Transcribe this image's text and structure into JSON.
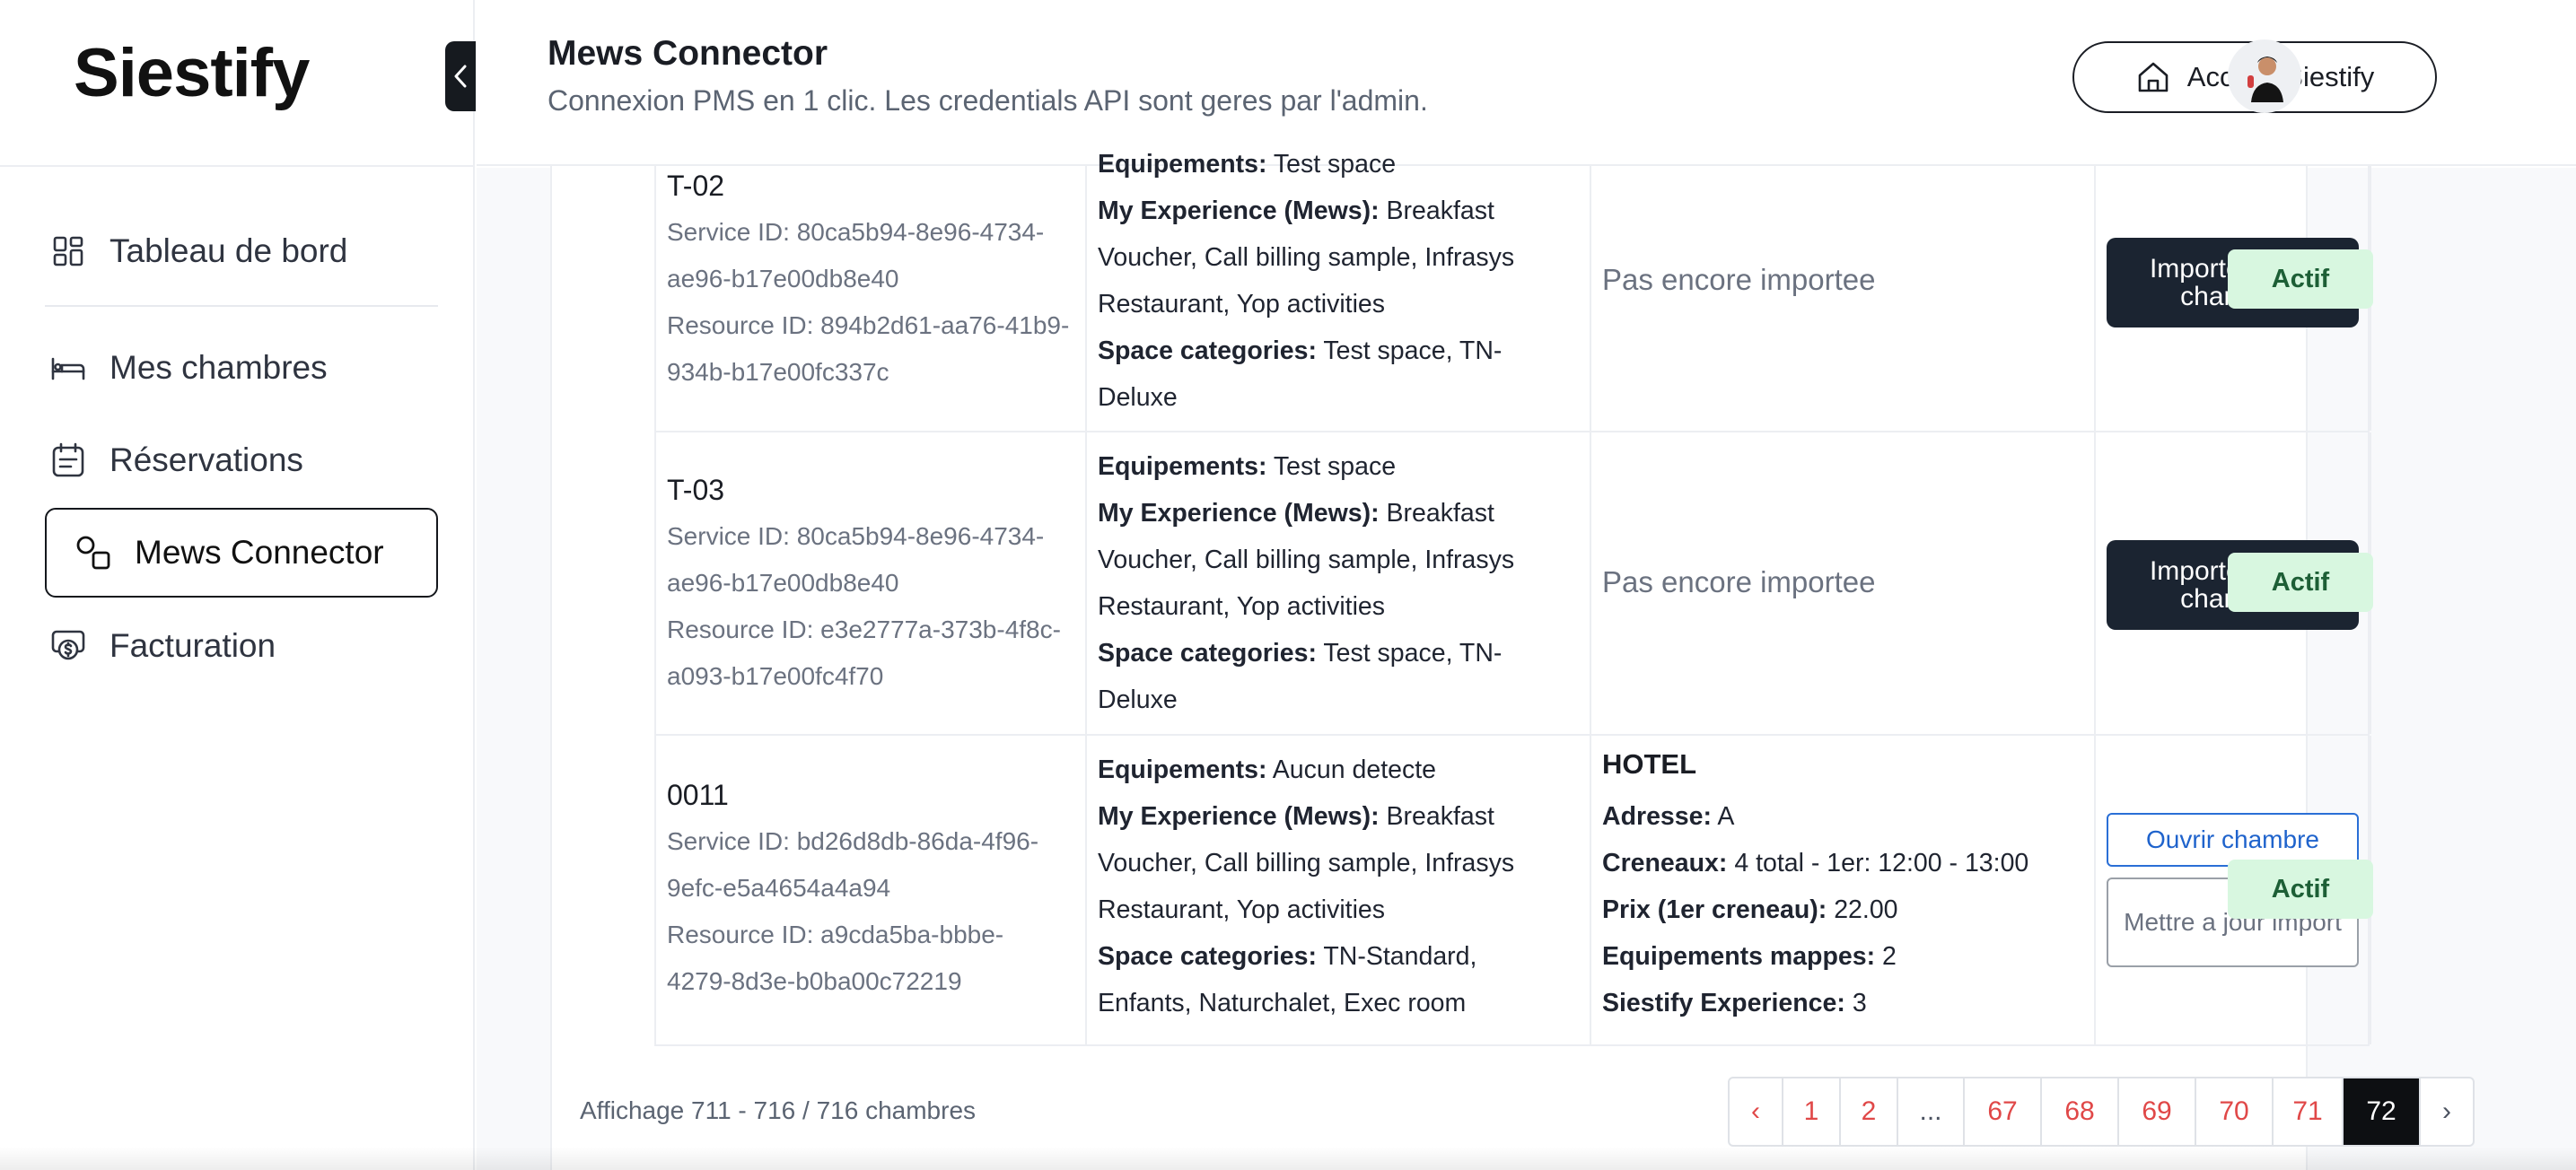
{
  "brand": {
    "logo_text": "Siestify"
  },
  "sidebar": {
    "items": [
      {
        "label": "Tableau de bord",
        "icon": "dashboard-icon"
      },
      {
        "label": "Mes chambres",
        "icon": "bed-icon"
      },
      {
        "label": "Réservations",
        "icon": "calendar-icon"
      },
      {
        "label": "Mews Connector",
        "icon": "connector-icon",
        "active": true
      },
      {
        "label": "Facturation",
        "icon": "billing-icon"
      }
    ]
  },
  "header": {
    "title": "Mews Connector",
    "subtitle": "Connexion PMS en 1 clic. Les credentials API sont geres par l'admin.",
    "home_button": "Accueil Siestify"
  },
  "rows": [
    {
      "code": "T-02",
      "service_id_1": "Service ID: 80ca5b94-8e96-4734-",
      "service_id_2": "ae96-b17e00db8e40",
      "resource_id_1": "Resource ID: 894b2d61-aa76-41b9-",
      "resource_id_2": "934b-b17e00fc337c",
      "equipements_label": "Equipements:",
      "equipements_value": "Test space",
      "experience_label": "My Experience (Mews):",
      "experience_value_1": "Breakfast",
      "experience_value_2": "Voucher, Call billing sample, Infrasys",
      "experience_value_3": "Restaurant, Yop activities",
      "space_label": "Space categories:",
      "space_value_1": "Test space, TN-",
      "space_value_2": "Deluxe",
      "import_status": "Pas encore importee",
      "action": "Importer cette chambre",
      "status": "Actif"
    },
    {
      "code": "T-03",
      "service_id_1": "Service ID: 80ca5b94-8e96-4734-",
      "service_id_2": "ae96-b17e00db8e40",
      "resource_id_1": "Resource ID: e3e2777a-373b-4f8c-",
      "resource_id_2": "a093-b17e00fc4f70",
      "equipements_label": "Equipements:",
      "equipements_value": "Test space",
      "experience_label": "My Experience (Mews):",
      "experience_value_1": "Breakfast",
      "experience_value_2": "Voucher, Call billing sample, Infrasys",
      "experience_value_3": "Restaurant, Yop activities",
      "space_label": "Space categories:",
      "space_value_1": "Test space, TN-",
      "space_value_2": "Deluxe",
      "import_status": "Pas encore importee",
      "action": "Importer cette chambre",
      "status": "Actif"
    },
    {
      "code": "0011",
      "service_id_1": "Service ID: bd26d8db-86da-4f96-",
      "service_id_2": "9efc-e5a4654a4a94",
      "resource_id_1": "Resource ID: a9cda5ba-bbbe-",
      "resource_id_2": "4279-8d3e-b0ba00c72219",
      "equipements_label": "Equipements:",
      "equipements_value": "Aucun detecte",
      "experience_label": "My Experience (Mews):",
      "experience_value_1": "Breakfast",
      "experience_value_2": "Voucher, Call billing sample, Infrasys",
      "experience_value_3": "Restaurant, Yop activities",
      "space_label": "Space categories:",
      "space_value_1": "TN-Standard,",
      "space_value_2": "Enfants, Naturchalet, Exec room",
      "hotel": {
        "name": "HOTEL",
        "address_label": "Adresse:",
        "address_value": "A",
        "slots_label": "Creneaux:",
        "slots_value": "4 total - 1er: 12:00 - 13:00",
        "price_label": "Prix (1er creneau):",
        "price_value": "22.00",
        "equip_label": "Equipements mappes:",
        "equip_value": "2",
        "exp_label": "Siestify Experience:",
        "exp_value": "3"
      },
      "open_button": "Ouvrir chambre",
      "update_button": "Mettre a jour import",
      "status": "Actif"
    }
  ],
  "footer": {
    "showing": "Affichage 711 - 716 / 716 chambres",
    "pages": [
      "‹",
      "1",
      "2",
      "...",
      "67",
      "68",
      "69",
      "70",
      "71",
      "72",
      "›"
    ],
    "current_page": "72"
  },
  "colors": {
    "accent_dark": "#1b2431",
    "page_link": "#e04848",
    "active_badge_bg": "#d8f7e0",
    "open_button": "#2a6fd6"
  }
}
